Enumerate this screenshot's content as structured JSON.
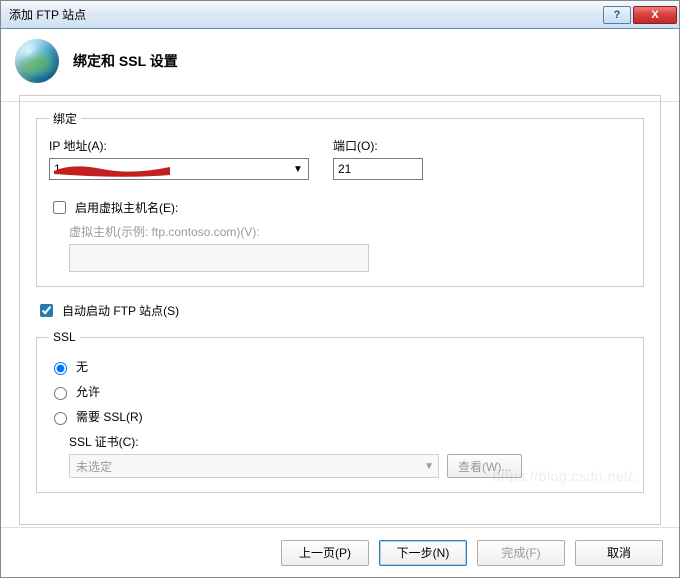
{
  "window": {
    "title": "添加 FTP 站点"
  },
  "header": {
    "title": "绑定和 SSL 设置"
  },
  "binding": {
    "legend": "绑定",
    "ip_label": "IP 地址(A):",
    "ip_value": "1",
    "port_label": "端口(O):",
    "port_value": "21",
    "vhost_checkbox_label": "启用虚拟主机名(E):",
    "vhost_checked": false,
    "vhost_example_label": "虚拟主机(示例: ftp.contoso.com)(V):"
  },
  "autostart": {
    "label": "自动启动 FTP 站点(S)",
    "checked": true
  },
  "ssl": {
    "legend": "SSL",
    "options": {
      "none": "无",
      "allow": "允许",
      "require": "需要 SSL(R)"
    },
    "selected": "none",
    "cert_label": "SSL 证书(C):",
    "cert_value": "未选定",
    "view_button": "查看(W)..."
  },
  "footer": {
    "prev": "上一页(P)",
    "next": "下一步(N)",
    "finish": "完成(F)",
    "cancel": "取消"
  },
  "titlebar": {
    "help": "?",
    "close": "X"
  }
}
